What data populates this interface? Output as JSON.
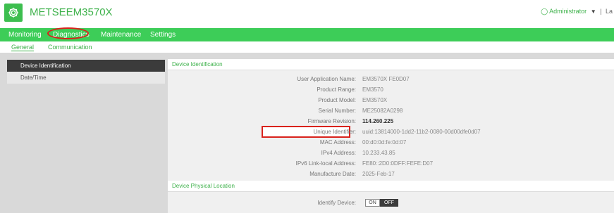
{
  "header": {
    "title": "METSEEM3570X",
    "user_label": "Administrator",
    "separator": "|",
    "truncated": "La"
  },
  "nav": {
    "items": [
      {
        "label": "Monitoring"
      },
      {
        "label": "Diagnostics"
      },
      {
        "label": "Maintenance"
      },
      {
        "label": "Settings"
      }
    ]
  },
  "subnav": {
    "items": [
      {
        "label": "General"
      },
      {
        "label": "Communication"
      }
    ]
  },
  "sidebar": {
    "items": [
      {
        "label": "Device Identification"
      },
      {
        "label": "Date/Time"
      }
    ]
  },
  "device_identification": {
    "heading": "Device Identification",
    "rows": [
      {
        "label": "User Application Name:",
        "value": "EM3570X FE0D07"
      },
      {
        "label": "Product Range:",
        "value": "EM3570"
      },
      {
        "label": "Product Model:",
        "value": "EM3570X"
      },
      {
        "label": "Serial Number:",
        "value": "ME25082A0298"
      },
      {
        "label": "Firmware Revision:",
        "value": "114.260.225"
      },
      {
        "label": "Unique Identifier:",
        "value": "uuid:13814000-1dd2-11b2-0080-00d00dfe0d07"
      },
      {
        "label": "MAC Address:",
        "value": "00:d0:0d:fe:0d:07"
      },
      {
        "label": "IPv4 Address:",
        "value": "10.233.43.85"
      },
      {
        "label": "IPv6 Link-local Address:",
        "value": "FE80::2D0:0DFF:FEFE:D07"
      },
      {
        "label": "Manufacture Date:",
        "value": "2025-Feb-17"
      }
    ]
  },
  "physical_location": {
    "heading": "Device Physical Location",
    "identify_label": "Identify Device:",
    "on_label": "ON",
    "off_label": "OFF"
  },
  "colors": {
    "brand_green": "#3dcd58",
    "highlight_red": "#d9221c"
  }
}
